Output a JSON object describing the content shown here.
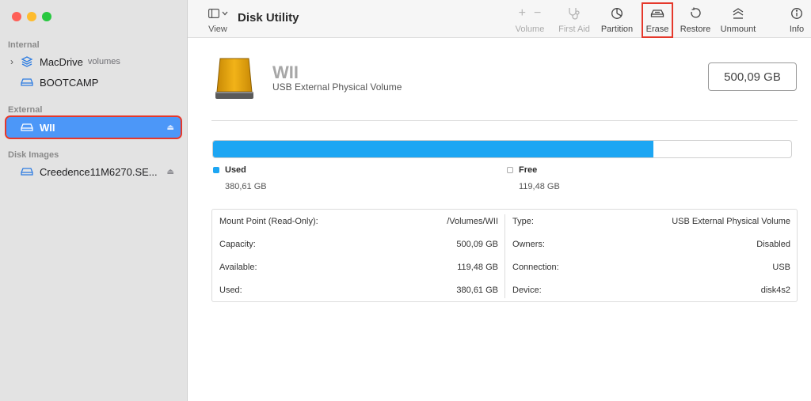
{
  "toolbar": {
    "view_label": "View",
    "title": "Disk Utility",
    "buttons": {
      "volume": "Volume",
      "first_aid": "First Aid",
      "partition": "Partition",
      "erase": "Erase",
      "restore": "Restore",
      "unmount": "Unmount",
      "info": "Info"
    },
    "volume_plus": "+",
    "volume_minus": "−"
  },
  "sidebar": {
    "internal_head": "Internal",
    "external_head": "External",
    "disk_images_head": "Disk Images",
    "items": [
      {
        "label": "MacDrive",
        "sub": "volumes",
        "icon": "layers-icon"
      },
      {
        "label": "BOOTCAMP",
        "icon": "disk-icon"
      },
      {
        "label": "WII",
        "icon": "disk-icon"
      },
      {
        "label": "Creedence11M6270.SE...",
        "icon": "disk-icon"
      }
    ],
    "eject_glyph": "⏏"
  },
  "volume": {
    "name": "WII",
    "description": "USB External Physical Volume",
    "capacity_badge": "500,09 GB",
    "used_fraction": 0.761
  },
  "usage": {
    "used_label": "Used",
    "used_value": "380,61 GB",
    "free_label": "Free",
    "free_value": "119,48 GB"
  },
  "info_left": [
    {
      "k": "Mount Point (Read-Only):",
      "v": "/Volumes/WII"
    },
    {
      "k": "Capacity:",
      "v": "500,09 GB"
    },
    {
      "k": "Available:",
      "v": "119,48 GB"
    },
    {
      "k": "Used:",
      "v": "380,61 GB"
    }
  ],
  "info_right": [
    {
      "k": "Type:",
      "v": "USB External Physical Volume"
    },
    {
      "k": "Owners:",
      "v": "Disabled"
    },
    {
      "k": "Connection:",
      "v": "USB"
    },
    {
      "k": "Device:",
      "v": "disk4s2"
    }
  ],
  "colors": {
    "used": "#1da6f3",
    "selection": "#4c97f8",
    "highlight": "#e5382b"
  }
}
